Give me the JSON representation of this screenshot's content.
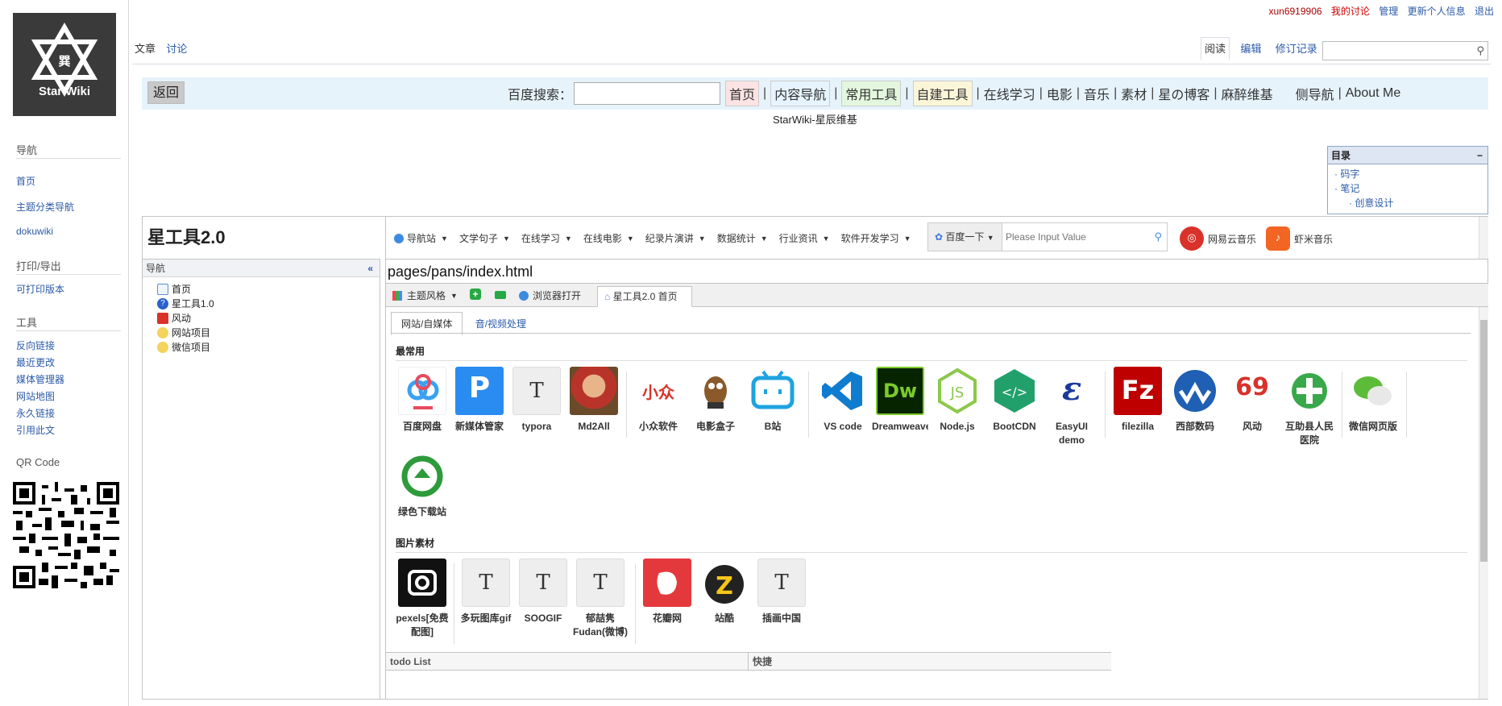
{
  "user_bar": {
    "username": "xun6919906",
    "links": [
      "我的讨论",
      "管理",
      "更新个人信息",
      "退出"
    ]
  },
  "logo": {
    "glyph": "巽",
    "text": "Star Wiki"
  },
  "sidebar": {
    "sections": [
      {
        "title": "导航",
        "items": [
          "首页",
          "主题分类导航",
          "dokuwiki"
        ]
      },
      {
        "title": "打印/导出",
        "items": [
          "可打印版本"
        ]
      },
      {
        "title": "工具",
        "items": [
          "反向链接",
          "最近更改",
          "媒体管理器",
          "网站地图",
          "永久链接",
          "引用此文"
        ]
      },
      {
        "title": "QR Code",
        "items": []
      }
    ]
  },
  "page_tabs": {
    "left": [
      "文章",
      "讨论"
    ],
    "right": [
      "阅读",
      "编辑",
      "修订记录"
    ]
  },
  "navbar": {
    "back": "返回",
    "search_label": "百度搜索：",
    "items": [
      "首页",
      "内容导航",
      "常用工具",
      "自建工具",
      "在线学习",
      "电影",
      "音乐",
      "素材",
      "星の博客",
      "麻醉维基",
      "侧导航",
      "About Me"
    ]
  },
  "subtitle": "StarWiki-星辰维基",
  "toc": {
    "title": "目录",
    "toggle": "−",
    "items": [
      "码字",
      "笔记",
      "创意设计"
    ]
  },
  "app": {
    "title": "星工具2.0",
    "nav_header": "导航",
    "collapse": "«",
    "tree": [
      "首页",
      "星工具1.0",
      "风动",
      "网站项目",
      "微信项目"
    ],
    "toolbar": [
      "导航站",
      "文学句子",
      "在线学习",
      "在线电影",
      "纪录片演讲",
      "数据统计",
      "行业资讯",
      "软件开发学习"
    ],
    "baidu_button": "百度一下",
    "baidu_placeholder": "Please Input Value",
    "music": [
      "网易云音乐",
      "虾米音乐"
    ],
    "path": "pages/pans/index.html",
    "tabbar": {
      "theme": "主题风格",
      "browser": "浏览器打开",
      "home": "星工具2.0 首页"
    },
    "subtabs": [
      "网站/自媒体",
      "音/视频处理"
    ],
    "section1_title": "最常用",
    "section1": [
      "百度网盘",
      "新媒体管家",
      "typora",
      "Md2All",
      "小众软件",
      "电影盒子",
      "B站",
      "VS code",
      "Dreamweaver",
      "Node.js",
      "BootCDN",
      "EasyUI demo",
      "filezilla",
      "西部数码",
      "风动",
      "互助县人民医院",
      "微信网页版",
      "绿色下载站"
    ],
    "section2_title": "图片素材",
    "section2": [
      "pexels[免费配图]",
      "多玩图库gif",
      "SOOGIF",
      "郁喆隽Fudan(微博)",
      "花瓣网",
      "站酷",
      "插画中国"
    ],
    "todo": [
      "todo List",
      "快捷"
    ]
  },
  "colors": {
    "accent": "#2b5aa8",
    "navbar_bg": "#e6f3fb"
  }
}
